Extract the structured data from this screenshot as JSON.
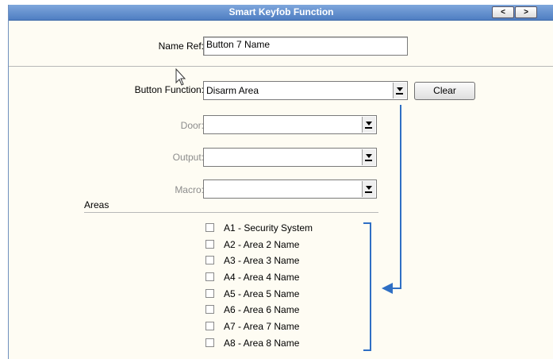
{
  "window": {
    "title": "Smart Keyfob Function",
    "prev_label": "<",
    "next_label": ">"
  },
  "name_ref": {
    "label": "Name Ref:",
    "value": "Button 7 Name"
  },
  "button_function": {
    "label": "Button Function:",
    "value": "Disarm Area",
    "clear_label": "Clear"
  },
  "door": {
    "label": "Door:",
    "value": ""
  },
  "output": {
    "label": "Output:",
    "value": ""
  },
  "macro": {
    "label": "Macro:",
    "value": ""
  },
  "areas": {
    "header": "Areas",
    "items": [
      {
        "label": "A1 - Security System",
        "checked": false
      },
      {
        "label": "A2 - Area 2 Name",
        "checked": false
      },
      {
        "label": "A3 - Area 3 Name",
        "checked": false
      },
      {
        "label": "A4 - Area 4 Name",
        "checked": false
      },
      {
        "label": "A5 - Area 5 Name",
        "checked": false
      },
      {
        "label": "A6 - Area 6 Name",
        "checked": false
      },
      {
        "label": "A7 - Area 7 Name",
        "checked": false
      },
      {
        "label": "A8 - Area 8 Name",
        "checked": false
      }
    ]
  },
  "colors": {
    "titlebar": "#5b89c9",
    "annotation": "#2f6fc4",
    "disabled_label": "#8c8c8c"
  }
}
